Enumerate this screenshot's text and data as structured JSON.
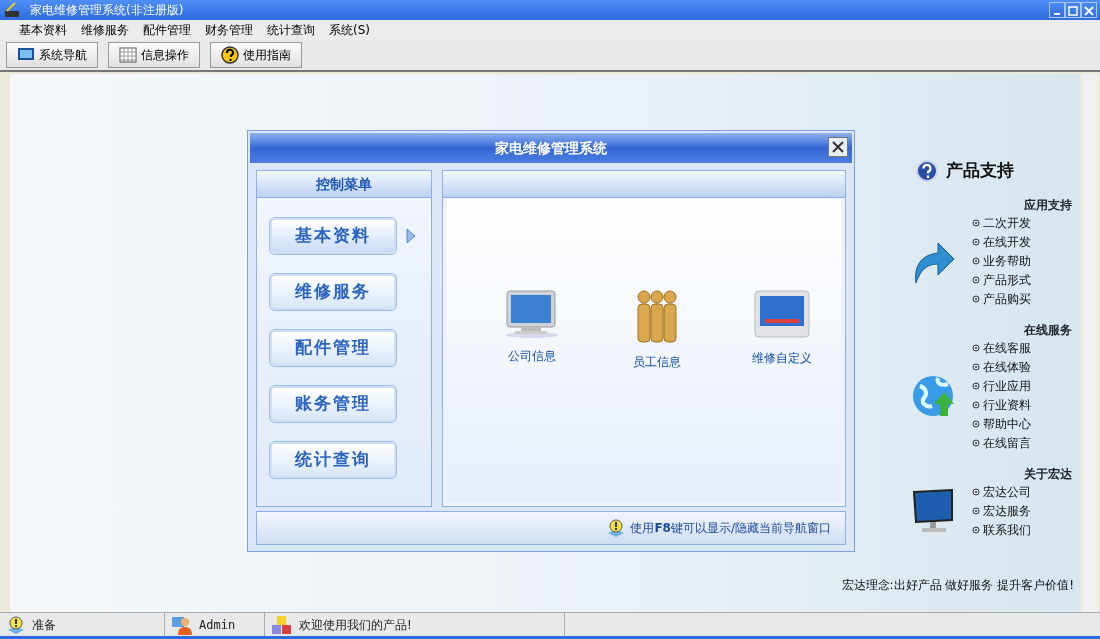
{
  "window": {
    "title": "家电维修管理系统(非注册版)"
  },
  "menu": [
    "基本资料",
    "维修服务",
    "配件管理",
    "财务管理",
    "统计查询",
    "系统(S)"
  ],
  "toolbar": [
    {
      "label": "系统导航",
      "kind": "monitor"
    },
    {
      "label": "信息操作",
      "kind": "grid"
    },
    {
      "label": "使用指南",
      "kind": "help"
    }
  ],
  "dialog": {
    "title": "家电维修管理系统",
    "sidebar_title": "控制菜单",
    "nav": [
      {
        "label": "基本资料",
        "selected": true
      },
      {
        "label": "维修服务",
        "selected": false
      },
      {
        "label": "配件管理",
        "selected": false
      },
      {
        "label": "账务管理",
        "selected": false
      },
      {
        "label": "统计查询",
        "selected": false
      }
    ],
    "items": [
      {
        "label": "公司信息",
        "kind": "computer"
      },
      {
        "label": "员工信息",
        "kind": "people"
      },
      {
        "label": "维修自定义",
        "kind": "screen"
      }
    ],
    "hint": "使用**F8**键可以显示/隐藏当前导航窗口"
  },
  "support": {
    "title": "产品支持",
    "sections": [
      {
        "heading": "应用支持",
        "kind": "arrow",
        "links": [
          "二次开发",
          "在线开发",
          "业务帮助",
          "产品形式",
          "产品购买"
        ]
      },
      {
        "heading": "在线服务",
        "kind": "globe",
        "links": [
          "在线客服",
          "在线体验",
          "行业应用",
          "行业资料",
          "帮助中心",
          "在线留言"
        ]
      },
      {
        "heading": "关于宏达",
        "kind": "monitor",
        "links": [
          "宏达公司",
          "宏达服务",
          "联系我们"
        ]
      }
    ],
    "slogan": "宏达理念:出好产品 做好服务 提升客户价值!"
  },
  "status_bar": [
    {
      "text": "准备",
      "kind": "bulb"
    },
    {
      "text": "Admin",
      "kind": "user"
    },
    {
      "text": "欢迎使用我们的产品!",
      "kind": "cubes"
    }
  ]
}
